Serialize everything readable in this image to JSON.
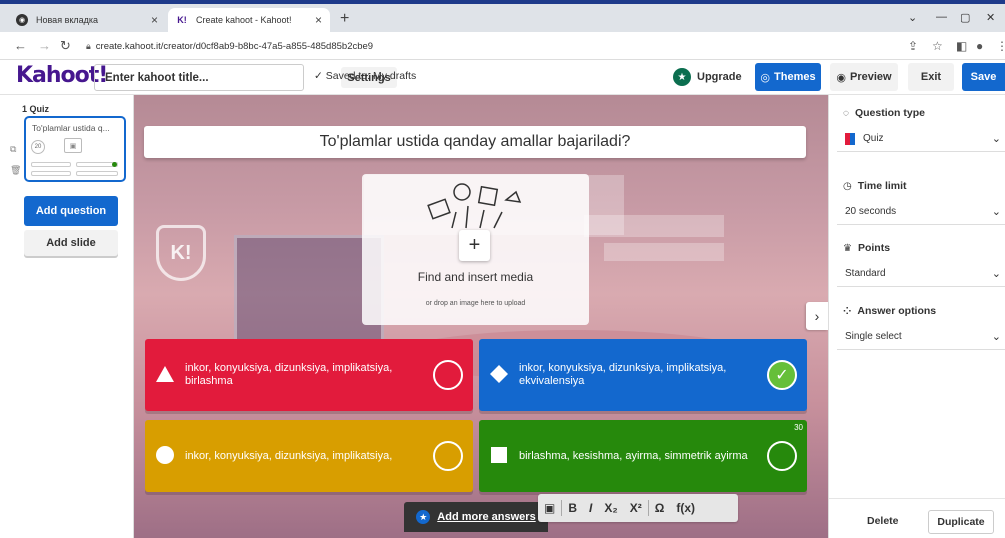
{
  "browser": {
    "tabs": [
      {
        "title": "Новая вкладка",
        "active": false
      },
      {
        "title": "Create kahoot - Kahoot!",
        "active": true
      }
    ],
    "url": "create.kahoot.it/creator/d0cf8ab9-b8bc-47a5-a855-485d85b2cbe9"
  },
  "header": {
    "logo": "Kahoot!",
    "title_placeholder": "Enter kahoot title...",
    "settings_label": "Settings",
    "saved_text": "Saved to: My drafts",
    "upgrade_label": "Upgrade",
    "themes_label": "Themes",
    "preview_label": "Preview",
    "exit_label": "Exit",
    "save_label": "Save"
  },
  "sidebar": {
    "slide_label": "1 Quiz",
    "slide_preview": "To'plamlar ustida q...",
    "slide_time": "20",
    "add_question_label": "Add question",
    "add_slide_label": "Add slide"
  },
  "canvas": {
    "question": "To'plamlar ustida qanday amallar bajariladi?",
    "media_title": "Find and insert media",
    "media_subtitle": "or drop an image here to upload",
    "answers": [
      {
        "text": "inkor, konyuksiya, dizunksiya, implikatsiya, birlashma",
        "color": "#e21b3c",
        "shape": "triangle",
        "correct": false
      },
      {
        "text": "inkor, konyuksiya, dizunksiya, implikatsiya, ekvivalensiya",
        "color": "#1368ce",
        "shape": "diamond",
        "correct": true
      },
      {
        "text": "inkor, konyuksiya, dizunksiya, implikatsiya,",
        "color": "#d89e00",
        "shape": "circle",
        "correct": false
      },
      {
        "text": "birlashma, kesishma, ayirma, simmetrik ayirma",
        "color": "#26890c",
        "shape": "square",
        "correct": false,
        "char_count": "30"
      }
    ],
    "add_more_label": "Add more answers",
    "format_buttons": [
      "B",
      "I",
      "X₂",
      "X²",
      "Ω",
      "f(x)"
    ]
  },
  "right_panel": {
    "question_type_label": "Question type",
    "question_type_value": "Quiz",
    "time_limit_label": "Time limit",
    "time_limit_value": "20 seconds",
    "points_label": "Points",
    "points_value": "Standard",
    "answer_options_label": "Answer options",
    "answer_options_value": "Single select",
    "delete_label": "Delete",
    "duplicate_label": "Duplicate"
  },
  "colors": {
    "kahoot_purple": "#46178f",
    "primary_blue": "#1368ce",
    "correct_green": "#66bf39"
  }
}
